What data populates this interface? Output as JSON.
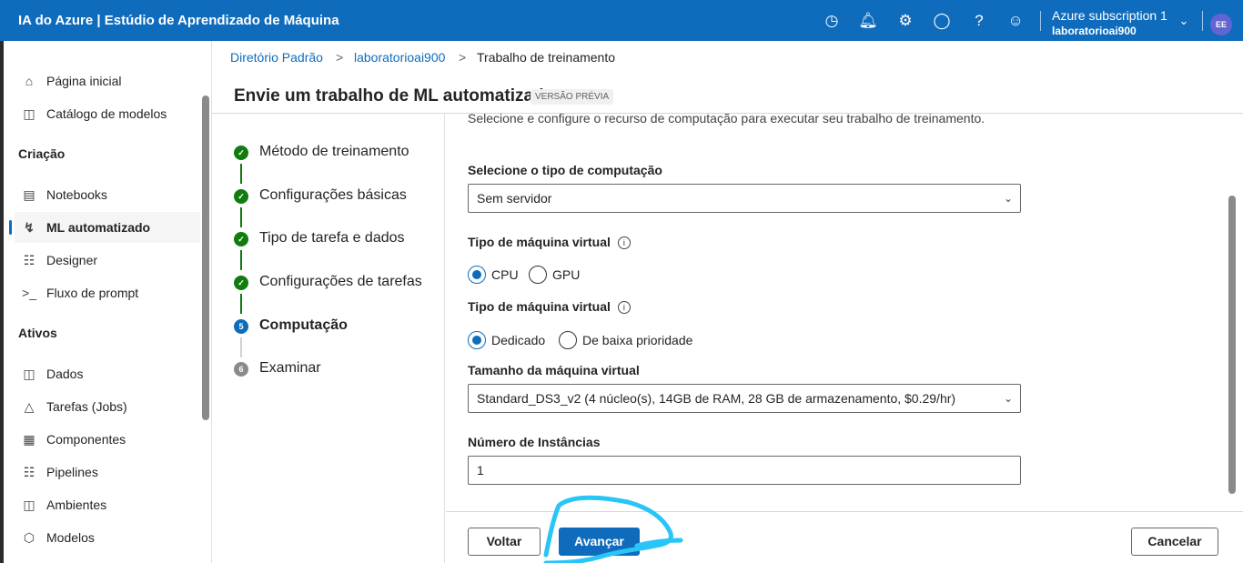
{
  "app": {
    "title": "IA do Azure | Estúdio de Aprendizado de Máquina",
    "subscription": "Azure subscription 1",
    "workspace": "laboratorioai900",
    "avatar": "EE",
    "icons": [
      "clock-icon",
      "bell-icon",
      "gear-icon",
      "megaphone-icon",
      "help-icon",
      "smiley-icon"
    ]
  },
  "sidebar": {
    "items": [
      {
        "label": "Página inicial",
        "icon": "home-icon"
      },
      {
        "label": "Catálogo de modelos",
        "icon": "catalog-icon"
      },
      {
        "label": "Notebooks",
        "icon": "notebook-icon"
      },
      {
        "label": "ML automatizado",
        "icon": "automl-icon",
        "active": true
      },
      {
        "label": "Designer",
        "icon": "designer-icon"
      },
      {
        "label": "Fluxo de prompt",
        "icon": "prompt-icon"
      },
      {
        "label": "Dados",
        "icon": "data-icon"
      },
      {
        "label": "Tarefas (Jobs)",
        "icon": "flask-icon"
      },
      {
        "label": "Componentes",
        "icon": "components-icon"
      },
      {
        "label": "Pipelines",
        "icon": "pipeline-icon"
      },
      {
        "label": "Ambientes",
        "icon": "environment-icon"
      },
      {
        "label": "Modelos",
        "icon": "cube-icon"
      }
    ],
    "sections": [
      "Criação",
      "Ativos"
    ]
  },
  "breadcrumb": [
    "Diretório Padrão",
    "laboratorioai900",
    "Trabalho de treinamento"
  ],
  "page": {
    "title": "Envie um trabalho de ML automatizado",
    "badge": "VERSÃO PRÉVIA"
  },
  "steps": [
    {
      "label": "Método de treinamento",
      "status": "done"
    },
    {
      "label": "Configurações básicas",
      "status": "done"
    },
    {
      "label": "Tipo de tarefa e dados",
      "status": "done"
    },
    {
      "label": "Configurações de tarefas",
      "status": "done"
    },
    {
      "label": "Computação",
      "status": "current",
      "number": "5"
    },
    {
      "label": "Examinar",
      "status": "pending",
      "number": "6"
    }
  ],
  "form": {
    "intro": "Selecione e configure o recurso de computação para executar seu trabalho de treinamento.",
    "compute_type_label": "Selecione o tipo de computação",
    "compute_type_value": "Sem servidor",
    "vm_type_label": "Tipo de máquina virtual",
    "vm_type_options": [
      "CPU",
      "GPU"
    ],
    "vm_type_selected": "CPU",
    "vm_tier_label": "Tipo de máquina virtual",
    "vm_tier_options": [
      "Dedicado",
      "De baixa prioridade"
    ],
    "vm_tier_selected": "Dedicado",
    "vm_size_label": "Tamanho da máquina virtual",
    "vm_size_value": "Standard_DS3_v2 (4 núcleo(s), 14GB de RAM, 28 GB de armazenamento, $0.29/hr)",
    "instances_label": "Número de Instâncias",
    "instances_value": "1"
  },
  "footer": {
    "back": "Voltar",
    "next": "Avançar",
    "cancel": "Cancelar"
  },
  "colors": {
    "brand": "#0f6cbd",
    "done": "#107c10",
    "annotation": "#29c5f6"
  }
}
